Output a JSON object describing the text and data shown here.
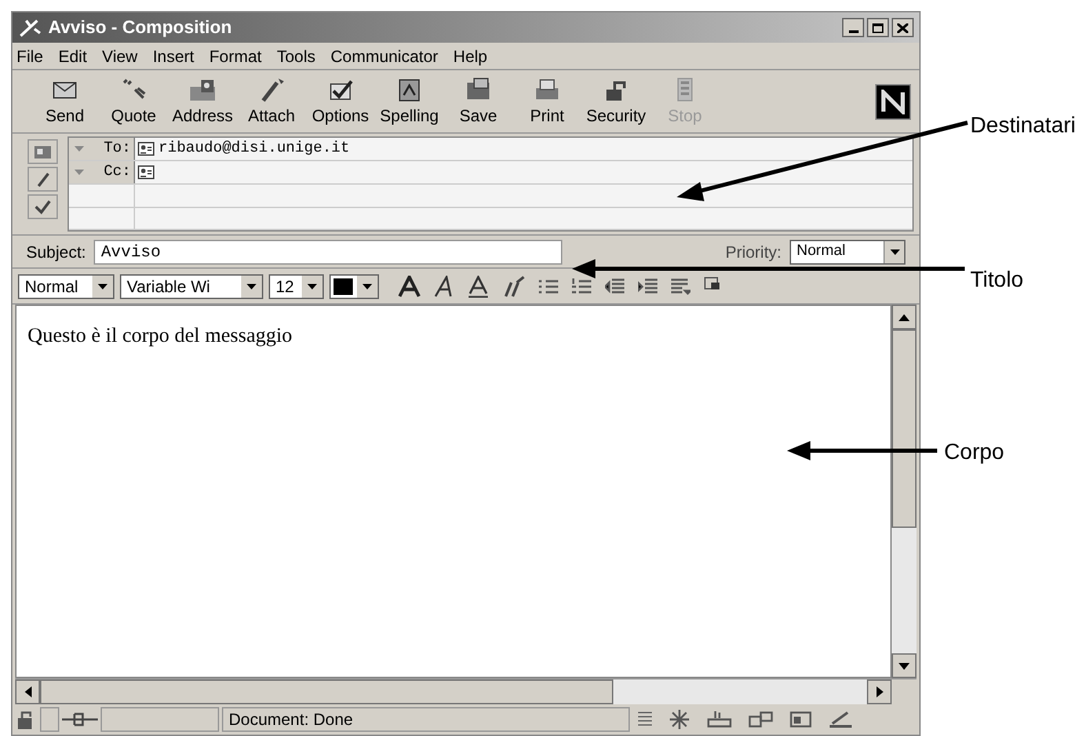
{
  "window": {
    "title": "Avviso - Composition"
  },
  "menu": [
    "File",
    "Edit",
    "View",
    "Insert",
    "Format",
    "Tools",
    "Communicator",
    "Help"
  ],
  "toolbar": [
    {
      "label": "Send",
      "disabled": false
    },
    {
      "label": "Quote",
      "disabled": false
    },
    {
      "label": "Address",
      "disabled": false
    },
    {
      "label": "Attach",
      "disabled": false
    },
    {
      "label": "Options",
      "disabled": false
    },
    {
      "label": "Spelling",
      "disabled": false
    },
    {
      "label": "Save",
      "disabled": false
    },
    {
      "label": "Print",
      "disabled": false
    },
    {
      "label": "Security",
      "disabled": false
    },
    {
      "label": "Stop",
      "disabled": true
    }
  ],
  "recipients": [
    {
      "field": "To:",
      "value": "ribaudo@disi.unige.it"
    },
    {
      "field": "Cc:"
    }
  ],
  "subject": {
    "label": "Subject:",
    "value": "Avviso"
  },
  "priority": {
    "label": "Priority:",
    "value": "Normal"
  },
  "format_bar": {
    "paragraph_style": "Normal",
    "font": "Variable Wi",
    "size": "12"
  },
  "body": "Questo è il corpo del messaggio",
  "status_bar": "Document: Done",
  "annotations": [
    {
      "label": "Destinatari"
    },
    {
      "label": "Titolo"
    },
    {
      "label": "Corpo"
    }
  ]
}
